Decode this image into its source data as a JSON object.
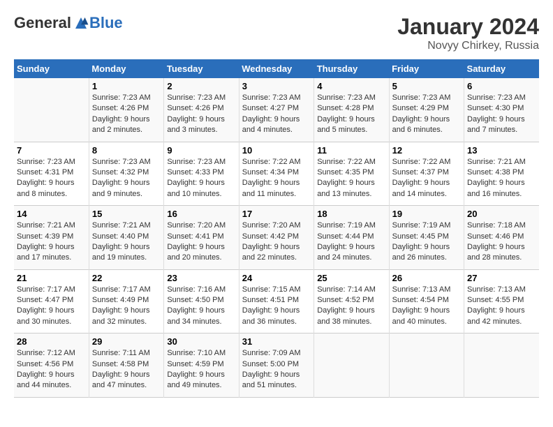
{
  "header": {
    "logo_general": "General",
    "logo_blue": "Blue",
    "month_year": "January 2024",
    "location": "Novyy Chirkey, Russia"
  },
  "days_of_week": [
    "Sunday",
    "Monday",
    "Tuesday",
    "Wednesday",
    "Thursday",
    "Friday",
    "Saturday"
  ],
  "weeks": [
    [
      {
        "day": "",
        "info": ""
      },
      {
        "day": "1",
        "info": "Sunrise: 7:23 AM\nSunset: 4:26 PM\nDaylight: 9 hours\nand 2 minutes."
      },
      {
        "day": "2",
        "info": "Sunrise: 7:23 AM\nSunset: 4:26 PM\nDaylight: 9 hours\nand 3 minutes."
      },
      {
        "day": "3",
        "info": "Sunrise: 7:23 AM\nSunset: 4:27 PM\nDaylight: 9 hours\nand 4 minutes."
      },
      {
        "day": "4",
        "info": "Sunrise: 7:23 AM\nSunset: 4:28 PM\nDaylight: 9 hours\nand 5 minutes."
      },
      {
        "day": "5",
        "info": "Sunrise: 7:23 AM\nSunset: 4:29 PM\nDaylight: 9 hours\nand 6 minutes."
      },
      {
        "day": "6",
        "info": "Sunrise: 7:23 AM\nSunset: 4:30 PM\nDaylight: 9 hours\nand 7 minutes."
      }
    ],
    [
      {
        "day": "7",
        "info": "Sunrise: 7:23 AM\nSunset: 4:31 PM\nDaylight: 9 hours\nand 8 minutes."
      },
      {
        "day": "8",
        "info": "Sunrise: 7:23 AM\nSunset: 4:32 PM\nDaylight: 9 hours\nand 9 minutes."
      },
      {
        "day": "9",
        "info": "Sunrise: 7:23 AM\nSunset: 4:33 PM\nDaylight: 9 hours\nand 10 minutes."
      },
      {
        "day": "10",
        "info": "Sunrise: 7:22 AM\nSunset: 4:34 PM\nDaylight: 9 hours\nand 11 minutes."
      },
      {
        "day": "11",
        "info": "Sunrise: 7:22 AM\nSunset: 4:35 PM\nDaylight: 9 hours\nand 13 minutes."
      },
      {
        "day": "12",
        "info": "Sunrise: 7:22 AM\nSunset: 4:37 PM\nDaylight: 9 hours\nand 14 minutes."
      },
      {
        "day": "13",
        "info": "Sunrise: 7:21 AM\nSunset: 4:38 PM\nDaylight: 9 hours\nand 16 minutes."
      }
    ],
    [
      {
        "day": "14",
        "info": "Sunrise: 7:21 AM\nSunset: 4:39 PM\nDaylight: 9 hours\nand 17 minutes."
      },
      {
        "day": "15",
        "info": "Sunrise: 7:21 AM\nSunset: 4:40 PM\nDaylight: 9 hours\nand 19 minutes."
      },
      {
        "day": "16",
        "info": "Sunrise: 7:20 AM\nSunset: 4:41 PM\nDaylight: 9 hours\nand 20 minutes."
      },
      {
        "day": "17",
        "info": "Sunrise: 7:20 AM\nSunset: 4:42 PM\nDaylight: 9 hours\nand 22 minutes."
      },
      {
        "day": "18",
        "info": "Sunrise: 7:19 AM\nSunset: 4:44 PM\nDaylight: 9 hours\nand 24 minutes."
      },
      {
        "day": "19",
        "info": "Sunrise: 7:19 AM\nSunset: 4:45 PM\nDaylight: 9 hours\nand 26 minutes."
      },
      {
        "day": "20",
        "info": "Sunrise: 7:18 AM\nSunset: 4:46 PM\nDaylight: 9 hours\nand 28 minutes."
      }
    ],
    [
      {
        "day": "21",
        "info": "Sunrise: 7:17 AM\nSunset: 4:47 PM\nDaylight: 9 hours\nand 30 minutes."
      },
      {
        "day": "22",
        "info": "Sunrise: 7:17 AM\nSunset: 4:49 PM\nDaylight: 9 hours\nand 32 minutes."
      },
      {
        "day": "23",
        "info": "Sunrise: 7:16 AM\nSunset: 4:50 PM\nDaylight: 9 hours\nand 34 minutes."
      },
      {
        "day": "24",
        "info": "Sunrise: 7:15 AM\nSunset: 4:51 PM\nDaylight: 9 hours\nand 36 minutes."
      },
      {
        "day": "25",
        "info": "Sunrise: 7:14 AM\nSunset: 4:52 PM\nDaylight: 9 hours\nand 38 minutes."
      },
      {
        "day": "26",
        "info": "Sunrise: 7:13 AM\nSunset: 4:54 PM\nDaylight: 9 hours\nand 40 minutes."
      },
      {
        "day": "27",
        "info": "Sunrise: 7:13 AM\nSunset: 4:55 PM\nDaylight: 9 hours\nand 42 minutes."
      }
    ],
    [
      {
        "day": "28",
        "info": "Sunrise: 7:12 AM\nSunset: 4:56 PM\nDaylight: 9 hours\nand 44 minutes."
      },
      {
        "day": "29",
        "info": "Sunrise: 7:11 AM\nSunset: 4:58 PM\nDaylight: 9 hours\nand 47 minutes."
      },
      {
        "day": "30",
        "info": "Sunrise: 7:10 AM\nSunset: 4:59 PM\nDaylight: 9 hours\nand 49 minutes."
      },
      {
        "day": "31",
        "info": "Sunrise: 7:09 AM\nSunset: 5:00 PM\nDaylight: 9 hours\nand 51 minutes."
      },
      {
        "day": "",
        "info": ""
      },
      {
        "day": "",
        "info": ""
      },
      {
        "day": "",
        "info": ""
      }
    ]
  ]
}
